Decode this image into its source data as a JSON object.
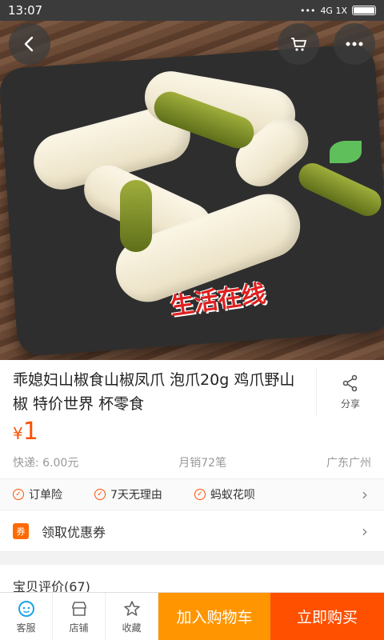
{
  "status_bar": {
    "time": "13:07",
    "network": "4G 1X"
  },
  "product": {
    "title": "乖媳妇山椒食山椒凤爪 泡爪20g 鸡爪野山椒 特价世界 杯零食",
    "currency": "¥",
    "price": "1",
    "shipping": "快递: 6.00元",
    "monthly_sales": "月销72笔",
    "location": "广东广州",
    "image_watermark": "生活在线"
  },
  "share_label": "分享",
  "guarantees": [
    "订单险",
    "7天无理由",
    "蚂蚁花呗"
  ],
  "coupon": {
    "badge": "券",
    "label": "领取优惠券"
  },
  "reviews_label": "宝贝评价(67)",
  "bottom_bar": {
    "service": "客服",
    "store": "店铺",
    "favorite": "收藏",
    "add_to_cart": "加入购物车",
    "buy_now": "立即购买"
  },
  "colors": {
    "accent": "#ff5000",
    "cart_button": "#ff9500"
  },
  "icons": [
    "back-icon",
    "cart-icon",
    "more-icon",
    "share-icon",
    "check-icon",
    "chevron-right-icon",
    "coupon-icon",
    "service-icon",
    "store-icon",
    "star-icon"
  ]
}
